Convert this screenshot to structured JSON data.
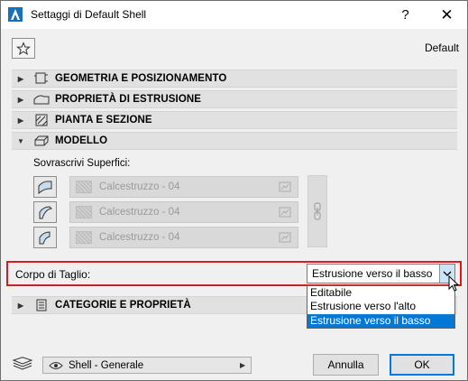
{
  "window": {
    "title": "Settaggi di Default Shell",
    "help_glyph": "?",
    "close_glyph": "✕"
  },
  "header": {
    "default_label": "Default"
  },
  "sections": [
    {
      "label": "GEOMETRIA E POSIZIONAMENTO",
      "expanded": false,
      "icon": "geometry-icon"
    },
    {
      "label": "PROPRIETÀ DI ESTRUSIONE",
      "expanded": false,
      "icon": "extrusion-icon"
    },
    {
      "label": "PIANTA E SEZIONE",
      "expanded": false,
      "icon": "floorplan-section-icon"
    },
    {
      "label": "MODELLO",
      "expanded": true,
      "icon": "model-icon"
    },
    {
      "label": "CATEGORIE E PROPRIETÀ",
      "expanded": false,
      "icon": "categories-icon"
    }
  ],
  "model": {
    "override_label": "Sovrascrivi Superfici:",
    "surfaces": [
      {
        "value": "Calcestruzzo - 04"
      },
      {
        "value": "Calcestruzzo - 04"
      },
      {
        "value": "Calcestruzzo - 04"
      }
    ]
  },
  "cut_body": {
    "label": "Corpo di Taglio:",
    "selected": "Estrusione verso il basso",
    "options": [
      "Editabile",
      "Estrusione verso l'alto",
      "Estrusione verso il basso"
    ],
    "highlighted_index": 2
  },
  "footer": {
    "profile": "Shell - Generale",
    "cancel_label": "Annulla",
    "ok_label": "OK"
  },
  "colors": {
    "highlight_border": "#e0161b",
    "selection": "#0078d7"
  }
}
